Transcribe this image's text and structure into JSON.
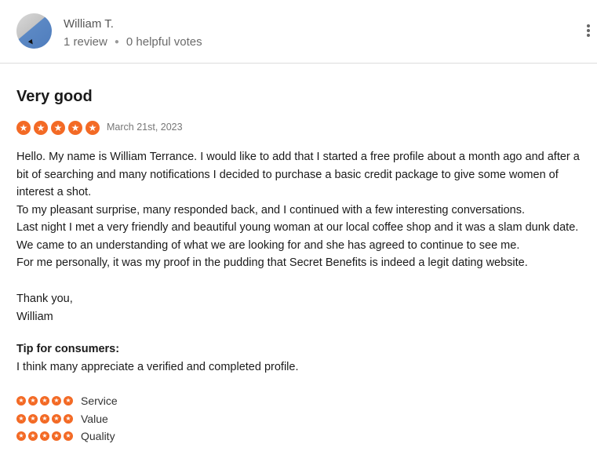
{
  "reviewer": {
    "name": "William T.",
    "reviews": "1 review",
    "helpful_votes": "0 helpful votes"
  },
  "review": {
    "title": "Very good",
    "rating": 5,
    "date": "March 21st, 2023",
    "paragraphs": [
      "Hello. My name is William Terrance. I would like to add that I started a free profile about a month ago and after a bit of searching and many notifications I decided to purchase a basic credit package to give some women of interest a shot.",
      "To my pleasant surprise, many responded back, and I continued with a few interesting conversations.",
      "Last night I met a very friendly and beautiful young woman at our local coffee shop and it was a slam dunk date. We came to an understanding of what we are looking for and she has agreed to continue to see me.",
      "For me personally, it was my proof in the pudding that Secret Benefits is indeed a legit dating website."
    ],
    "closing": [
      "Thank you,",
      "William"
    ],
    "tip_label": "Tip for consumers:",
    "tip_text": "I think many appreciate a verified and completed profile."
  },
  "sub_ratings": [
    {
      "label": "Service",
      "rating": 5
    },
    {
      "label": "Value",
      "rating": 5
    },
    {
      "label": "Quality",
      "rating": 5
    }
  ],
  "colors": {
    "star": "#f36a25"
  },
  "icons": {
    "star": "star-icon",
    "more": "more-vertical-icon"
  }
}
